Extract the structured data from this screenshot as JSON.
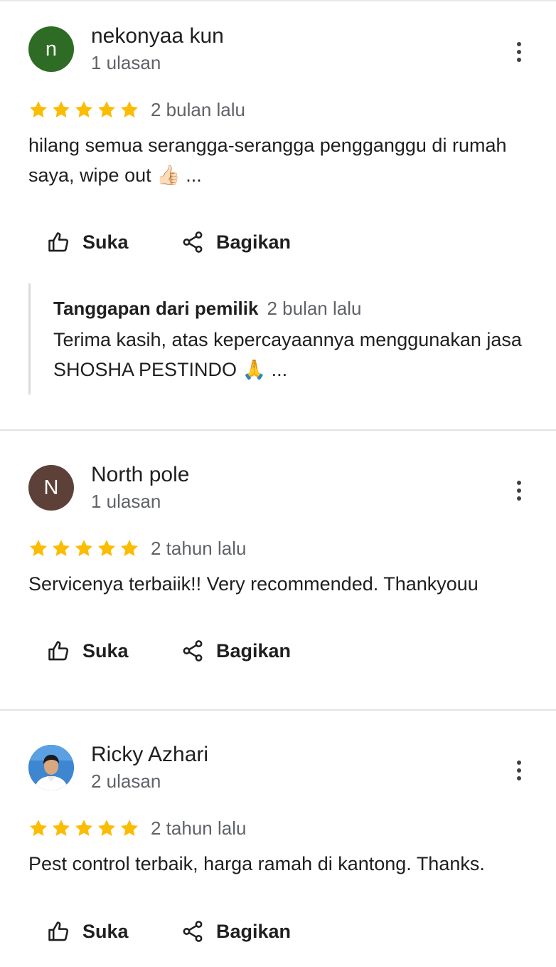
{
  "reviews": [
    {
      "avatar_letter": "n",
      "avatar_color": "#2e6b24",
      "name": "nekonyaa kun",
      "review_count": "1 ulasan",
      "rating": 5,
      "date": "2 bulan lalu",
      "text": "hilang semua serangga-serangga pengganggu di rumah saya, wipe out 👍🏻 ...",
      "like_label": "Suka",
      "share_label": "Bagikan",
      "owner_reply": {
        "title": "Tanggapan dari pemilik",
        "date": "2 bulan lalu",
        "text": "Terima kasih, atas kepercayaannya menggunakan jasa SHOSHA PESTINDO 🙏 ..."
      }
    },
    {
      "avatar_letter": "N",
      "avatar_color": "#5d4037",
      "name": "North pole",
      "review_count": "1 ulasan",
      "rating": 5,
      "date": "2 tahun lalu",
      "text": "Servicenya terbaiik!! Very recommended. Thankyouu",
      "like_label": "Suka",
      "share_label": "Bagikan"
    },
    {
      "avatar_type": "photo",
      "name": "Ricky Azhari",
      "review_count": "2 ulasan",
      "rating": 5,
      "date": "2 tahun lalu",
      "text": "Pest control terbaik, harga ramah di kantong. Thanks.",
      "like_label": "Suka",
      "share_label": "Bagikan"
    }
  ],
  "colors": {
    "star": "#fbbc04",
    "secondary_text": "#5f6368",
    "divider": "#e3e3e3"
  },
  "icons": {
    "more": "more-vert-icon",
    "like": "thumb-up-icon",
    "share": "share-icon",
    "star": "star-icon"
  }
}
